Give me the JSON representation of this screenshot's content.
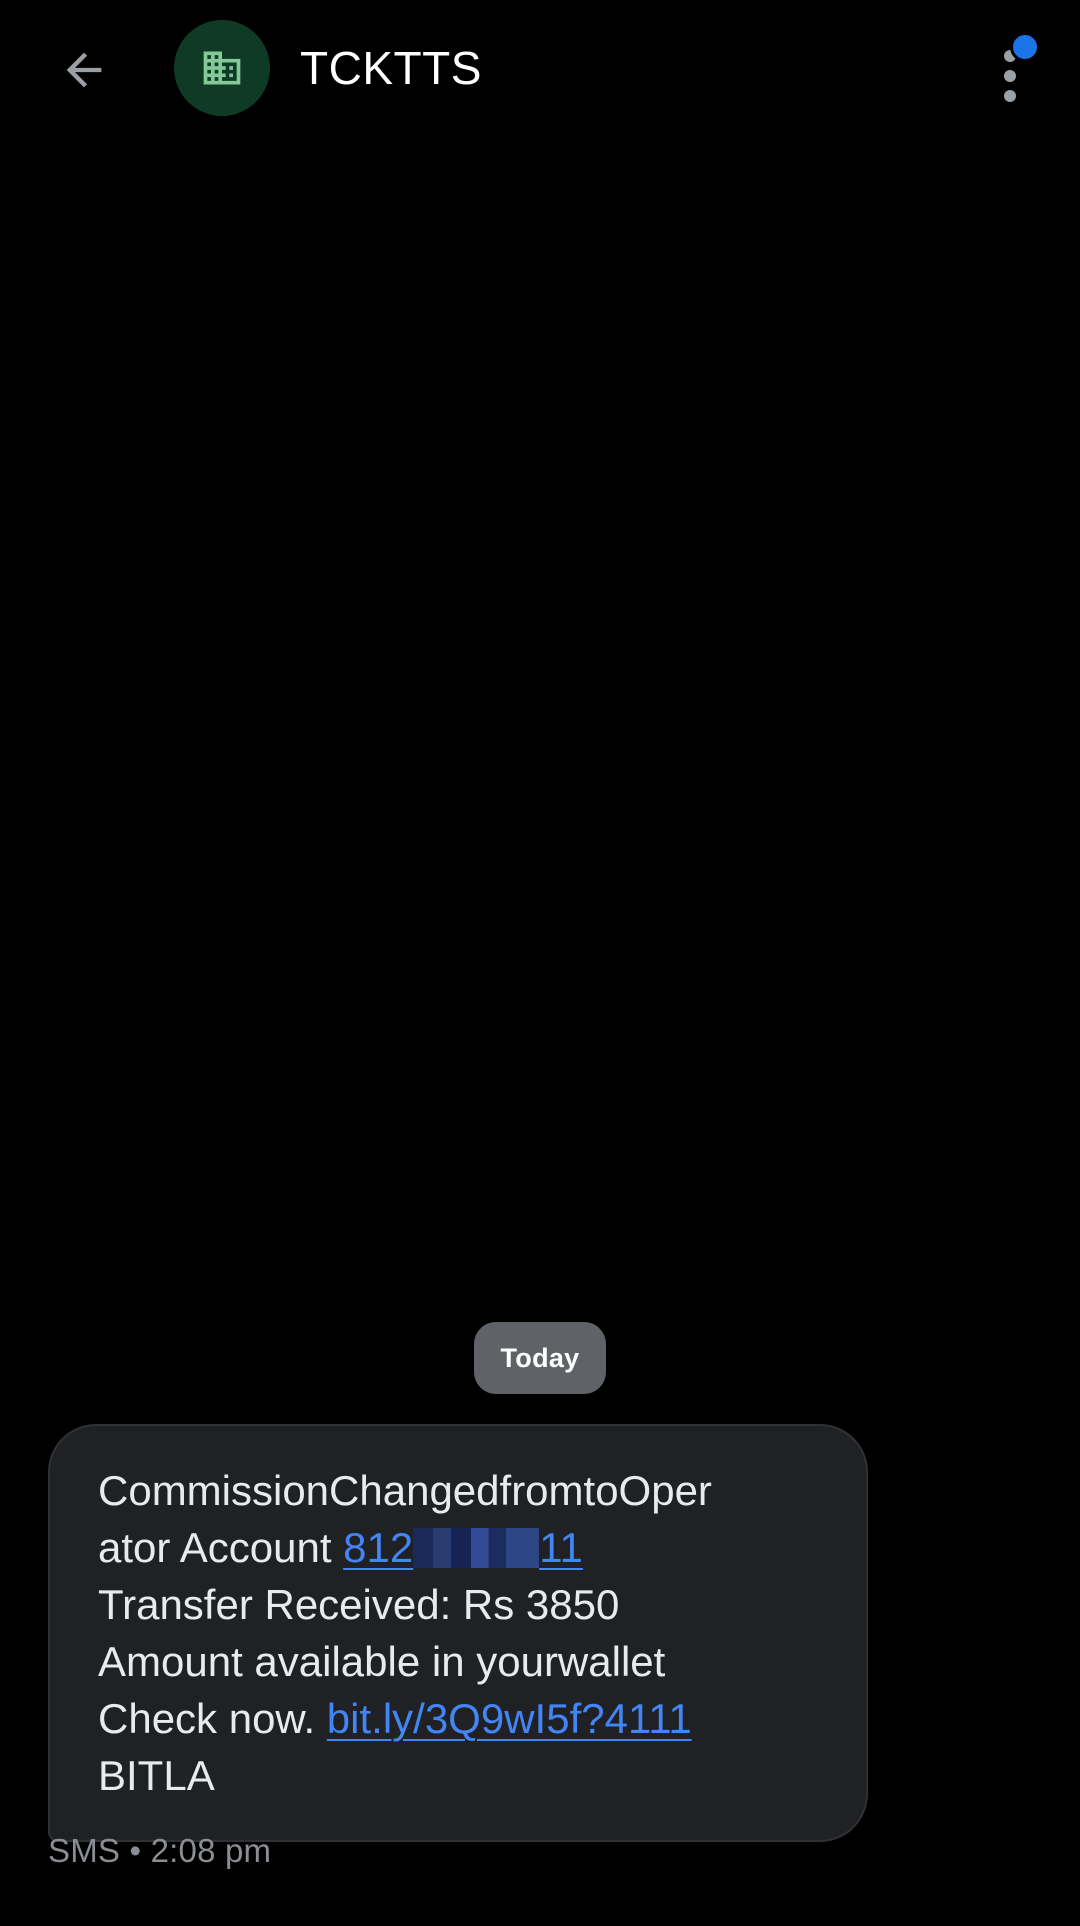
{
  "header": {
    "title": "TCKTTS",
    "back_icon": "arrow-back-icon",
    "avatar_icon": "business-building-icon",
    "menu_icon": "more-vert-icon"
  },
  "conversation": {
    "date_divider": "Today",
    "message": {
      "line1": "CommissionChangedfromtoOper",
      "line2_prefix": "ator Account ",
      "account_start": "812",
      "account_end": "11",
      "line3": "Transfer Received: Rs 3850",
      "line4": "Amount available in yourwallet",
      "line5_prefix": "Check now. ",
      "link": "bit.ly/3Q9wI5f?4111",
      "line6": "BITLA"
    },
    "meta": "SMS • 2:08 pm"
  },
  "colors": {
    "background": "#000000",
    "bubble": "#202124",
    "link": "#4285f4",
    "avatar_bg": "#0f3a25",
    "avatar_icon": "#81c995",
    "notification": "#1a73e8"
  }
}
